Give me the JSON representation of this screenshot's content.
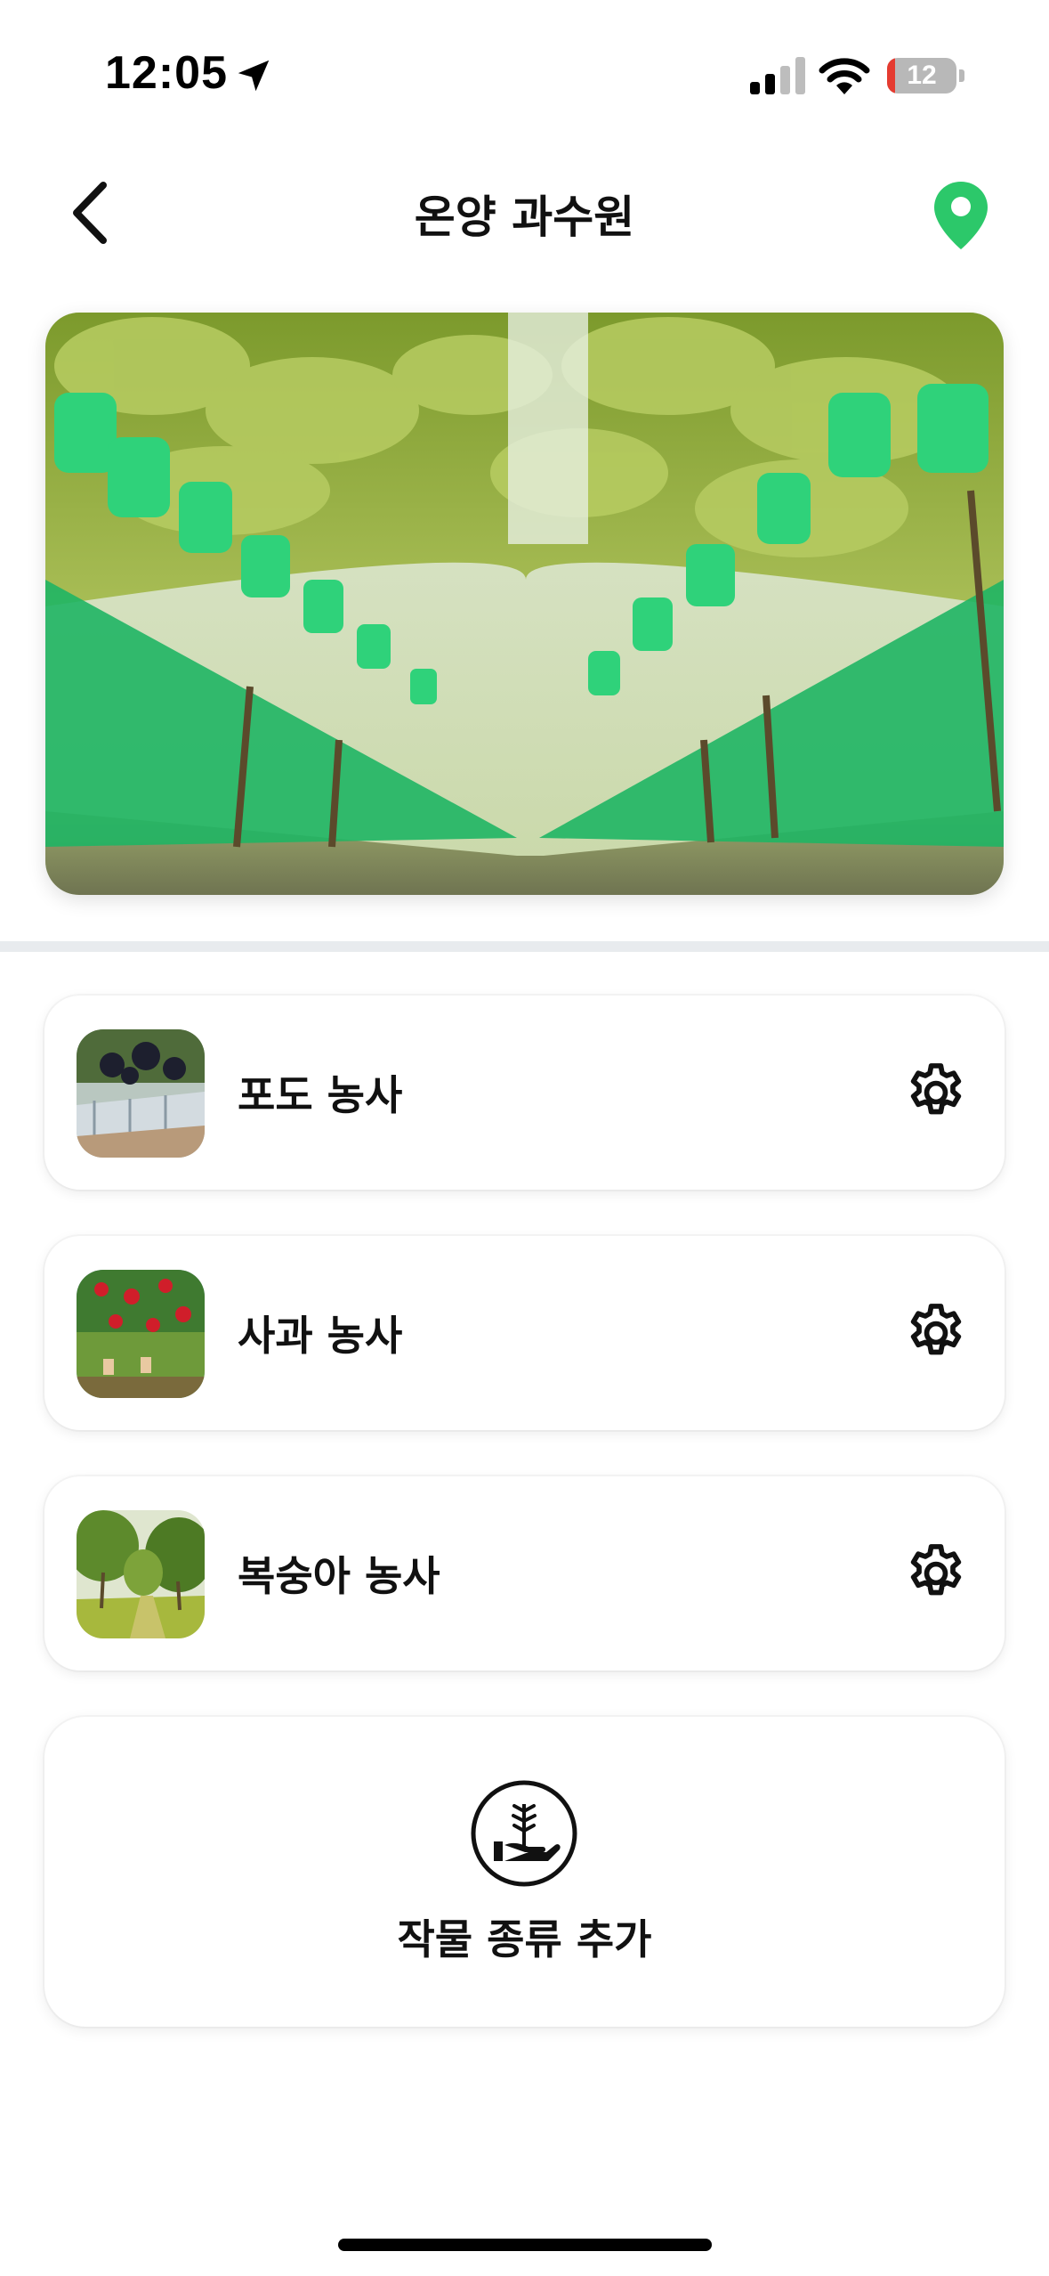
{
  "status_bar": {
    "time": "12:05",
    "battery_level": "12",
    "battery_fraction": 0.12,
    "icons": [
      "location-arrow-icon",
      "signal-bars-icon",
      "wifi-icon",
      "battery-icon"
    ]
  },
  "nav": {
    "title": "온양 과수원",
    "back_icon": "chevron-left-icon",
    "location_icon": "map-pin-icon"
  },
  "colors": {
    "accent_green": "#2cc86a",
    "battery_low": "#e53b30",
    "divider": "#e8ebee",
    "text": "#111111"
  },
  "crops": [
    {
      "label": "포도 농사",
      "thumbnail": "grape-farm-photo",
      "settings_icon": "gear-icon"
    },
    {
      "label": "사과 농사",
      "thumbnail": "apple-orchard-photo",
      "settings_icon": "gear-icon"
    },
    {
      "label": "복숭아 농사",
      "thumbnail": "peach-orchard-photo",
      "settings_icon": "gear-icon"
    }
  ],
  "add_crop": {
    "label": "작물 종류 추가",
    "icon": "plant-in-hand-icon"
  }
}
